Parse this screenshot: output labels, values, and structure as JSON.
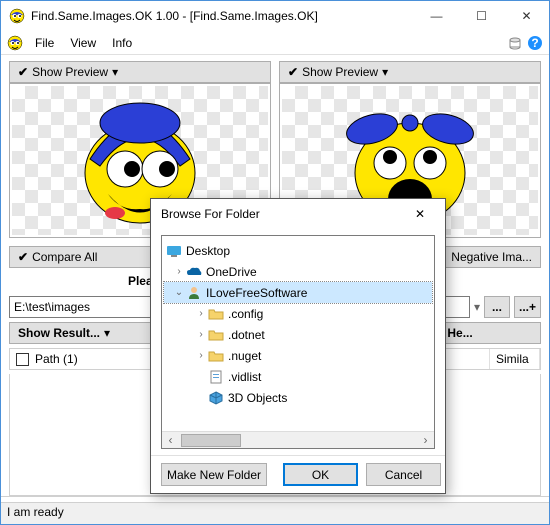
{
  "window": {
    "title": "Find.Same.Images.OK 1.00 - [Find.Same.Images.OK]"
  },
  "menu": {
    "file": "File",
    "view": "View",
    "info": "Info"
  },
  "preview": {
    "left_label": "Show Preview",
    "right_label": "Show Preview"
  },
  "options": {
    "compare": "Compare All",
    "negative": "Negative Ima..."
  },
  "instruct": "Please select the folders and press the Start Button",
  "path": {
    "value": "E:\\test\\images"
  },
  "buttons": {
    "browse": "...",
    "browse_plus": "...+",
    "show_result": "Show Result...",
    "donate": "Donate - He..."
  },
  "table": {
    "path": "Path (1)",
    "simila": "Simila"
  },
  "status": {
    "text": "I am ready"
  },
  "dialog": {
    "title": "Browse For Folder",
    "tree": {
      "desktop": "Desktop",
      "onedrive": "OneDrive",
      "user": "ILoveFreeSoftware",
      "config": ".config",
      "dotnet": ".dotnet",
      "nuget": ".nuget",
      "vidlist": ".vidlist",
      "objects3d": "3D Objects"
    },
    "make_new": "Make New Folder",
    "ok": "OK",
    "cancel": "Cancel"
  }
}
